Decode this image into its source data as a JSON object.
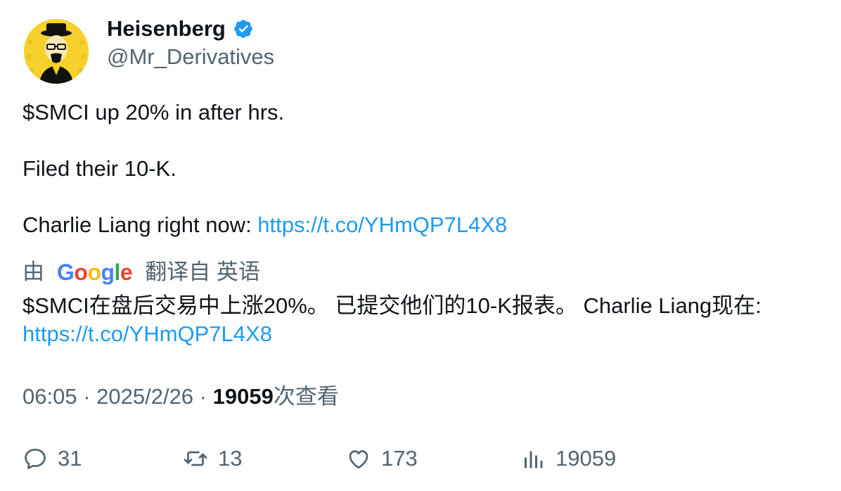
{
  "author": {
    "name": "Heisenberg",
    "handle": "@Mr_Derivatives",
    "avatar_icon": "heisenberg-avatar",
    "verified_icon": "verified-badge-icon"
  },
  "tweet": {
    "line1": "$SMCI up 20% in after hrs.",
    "line2": "Filed their 10-K.",
    "line3_prefix": "Charlie Liang right now: ",
    "line3_link": "https://t.co/YHmQP7L4X8"
  },
  "translation": {
    "prefix": "由",
    "provider": "Google",
    "suffix": "翻译自 英语",
    "text": "$SMCI在盘后交易中上涨20%。 已提交他们的10-K报表。 Charlie Liang现在:",
    "link": "https://t.co/YHmQP7L4X8"
  },
  "meta": {
    "time": "06:05",
    "sep1": " · ",
    "date": "2025/2/26",
    "sep2": " · ",
    "views_count": "19059",
    "views_label": "次查看"
  },
  "actions": {
    "replies": "31",
    "retweets": "13",
    "likes": "173",
    "views": "19059"
  },
  "colors": {
    "link": "#1d9bf0",
    "muted": "#536471",
    "verified": "#1d9bf0"
  }
}
